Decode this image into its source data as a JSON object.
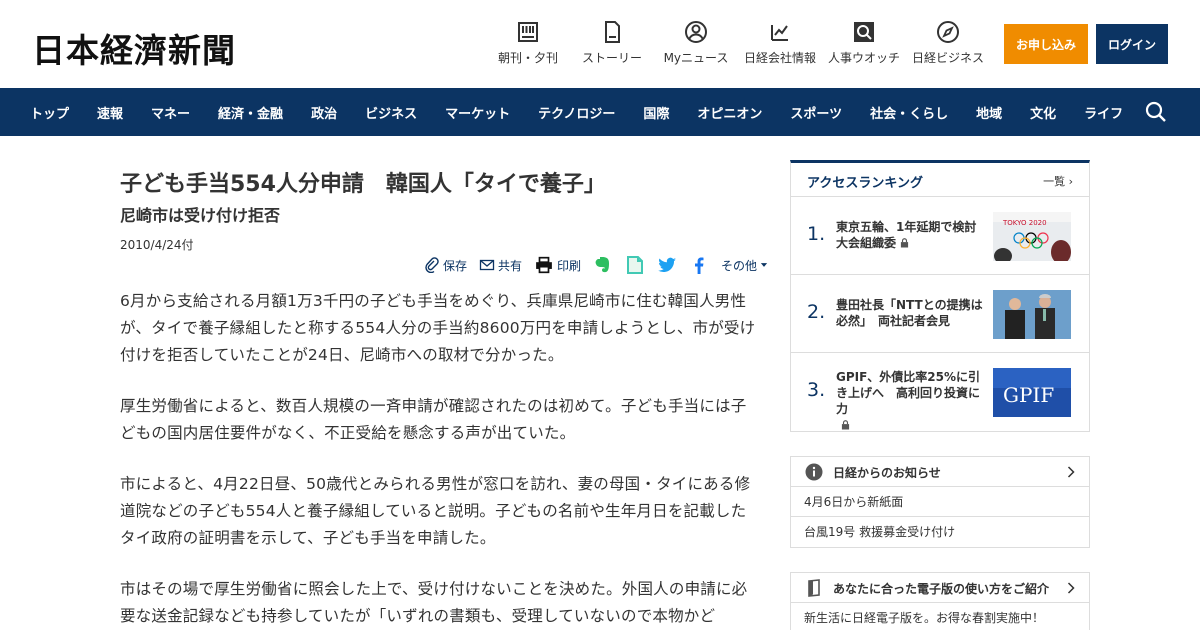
{
  "header": {
    "logo": "日本経濟新聞",
    "tools": [
      {
        "label": "朝刊・夕刊",
        "icon": "newspaper-icon"
      },
      {
        "label": "ストーリー",
        "icon": "document-icon"
      },
      {
        "label": "Myニュース",
        "icon": "user-icon"
      },
      {
        "label": "日経会社情報",
        "icon": "chart-icon"
      },
      {
        "label": "人事ウオッチ",
        "icon": "search-person-icon"
      },
      {
        "label": "日経ビジネス",
        "icon": "compass-icon"
      }
    ],
    "subscribe_label": "お申し込み",
    "login_label": "ログイン"
  },
  "nav": {
    "items": [
      "トップ",
      "速報",
      "マネー",
      "経済・金融",
      "政治",
      "ビジネス",
      "マーケット",
      "テクノロジー",
      "国際",
      "オピニオン",
      "スポーツ",
      "社会・くらし",
      "地域",
      "文化",
      "ライフ"
    ]
  },
  "article": {
    "title": "子ども手当554人分申請　韓国人「タイで養子」",
    "subtitle": "尼崎市は受け付け拒否",
    "date": "2010/4/24付",
    "share": {
      "save": "保存",
      "share": "共有",
      "print": "印刷",
      "more": "その他"
    },
    "paragraphs": [
      "6月から支給される月額1万3千円の子ども手当をめぐり、兵庫県尼崎市に住む韓国人男性が、タイで養子縁組したと称する554人分の手当約8600万円を申請しようとし、市が受け付けを拒否していたことが24日、尼崎市への取材で分かった。",
      "厚生労働省によると、数百人規模の一斉申請が確認されたのは初めて。子ども手当には子どもの国内居住要件がなく、不正受給を懸念する声が出ていた。",
      "市によると、4月22日昼、50歳代とみられる男性が窓口を訪れ、妻の母国・タイにある修道院などの子ども554人と養子縁組していると説明。子どもの名前や生年月日を記載したタイ政府の証明書を示して、子ども手当を申請した。",
      "市はその場で厚生労働省に照会した上で、受け付けないことを決めた。外国人の申請に必要な送金記録なども持参していたが「いずれの書類も、受理していないので本物かど"
    ]
  },
  "ranking": {
    "title": "アクセスランキング",
    "more": "一覧",
    "items": [
      {
        "rank": "1.",
        "text": "東京五輪、1年延期で検討　大会組織委"
      },
      {
        "rank": "2.",
        "text": "豊田社長「NTTとの提携は必然」　両社記者会見"
      },
      {
        "rank": "3.",
        "text": "GPIF、外債比率25%に引き上げへ　高利回り投資に力"
      }
    ],
    "img1_text": "TOKYO 2020",
    "img3_text": "GPIF"
  },
  "notice": {
    "title": "日経からのお知らせ",
    "items": [
      "4月6日から新紙面",
      "台風19号 救援募金受け付け"
    ]
  },
  "guide": {
    "title": "あなたに合った電子版の使い方をご紹介",
    "text": "新生活に日経電子版を。お得な春割実施中！"
  },
  "colors": {
    "brand": "#0c3463",
    "accent": "#f08c00"
  }
}
